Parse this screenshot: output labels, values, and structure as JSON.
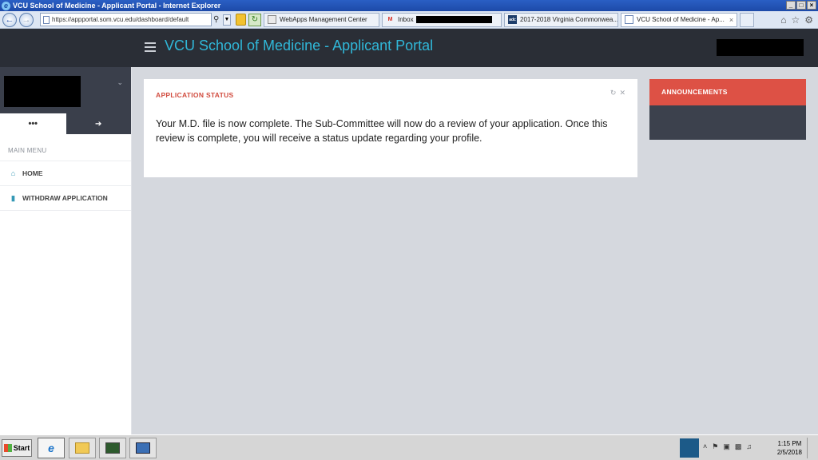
{
  "window": {
    "title": "VCU School of Medicine - Applicant Portal - Internet Explorer",
    "controls": [
      "_",
      "□",
      "×"
    ]
  },
  "browser": {
    "address": "https://appportal.som.vcu.edu/dashboard/default",
    "tabs": [
      {
        "label": "WebApps Management Center",
        "icon": "webapps-favicon"
      },
      {
        "label": "Inbox",
        "icon": "gmail-icon",
        "redacted": true
      },
      {
        "label": "2017-2018 Virginia Commonwea...",
        "icon": "adc-favicon"
      },
      {
        "label": "VCU School of Medicine - Ap...",
        "icon": "page-icon",
        "active": true,
        "close": "×"
      }
    ]
  },
  "portal": {
    "title": "VCU School of Medicine - Applicant Portal",
    "accent_color": "#30b8d9",
    "header_bg": "#2a2e36"
  },
  "sidebar": {
    "tools": [
      "•••",
      "➔"
    ],
    "menu_heading": "MAIN MENU",
    "items": [
      {
        "label": "HOME",
        "icon": "home-icon"
      },
      {
        "label": "WITHDRAW APPLICATION",
        "icon": "file-icon"
      }
    ]
  },
  "status_card": {
    "heading": "APPLICATION STATUS",
    "message": "Your M.D. file is now complete. The Sub-Committee will now do a review of your application. Once this review is complete, you will receive a status update regarding your profile."
  },
  "announcements": {
    "heading": "ANNOUNCEMENTS",
    "heading_color": "#dd5145"
  },
  "taskbar": {
    "start_label": "Start",
    "time": "1:15 PM",
    "date": "2/5/2018"
  }
}
